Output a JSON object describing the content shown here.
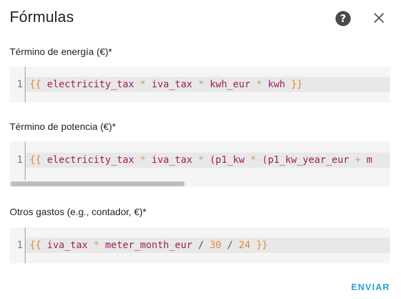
{
  "dialog": {
    "title": "Fórmulas",
    "help_icon": "help-circle-icon",
    "close_icon": "close-icon",
    "submit_label": "ENVIAR"
  },
  "fields": [
    {
      "label": "Término de energía (€)*",
      "line_number": "1",
      "tokens": [
        {
          "t": "{{",
          "c": "brace"
        },
        {
          "t": " ",
          "c": "sp"
        },
        {
          "t": "electricity_tax",
          "c": "var"
        },
        {
          "t": " ",
          "c": "sp"
        },
        {
          "t": "*",
          "c": "op"
        },
        {
          "t": " ",
          "c": "sp"
        },
        {
          "t": "iva_tax",
          "c": "var"
        },
        {
          "t": " ",
          "c": "sp"
        },
        {
          "t": "*",
          "c": "op"
        },
        {
          "t": " ",
          "c": "sp"
        },
        {
          "t": "kwh_eur",
          "c": "var"
        },
        {
          "t": " ",
          "c": "sp"
        },
        {
          "t": "*",
          "c": "op"
        },
        {
          "t": " ",
          "c": "sp"
        },
        {
          "t": "kwh",
          "c": "var"
        },
        {
          "t": " ",
          "c": "sp"
        },
        {
          "t": "}}",
          "c": "brace"
        }
      ]
    },
    {
      "label": "Término de potencia (€)*",
      "line_number": "1",
      "tokens": [
        {
          "t": "{{",
          "c": "brace"
        },
        {
          "t": " ",
          "c": "sp"
        },
        {
          "t": "electricity_tax",
          "c": "var"
        },
        {
          "t": " ",
          "c": "sp"
        },
        {
          "t": "*",
          "c": "op"
        },
        {
          "t": " ",
          "c": "sp"
        },
        {
          "t": "iva_tax",
          "c": "var"
        },
        {
          "t": " ",
          "c": "sp"
        },
        {
          "t": "*",
          "c": "op"
        },
        {
          "t": " ",
          "c": "sp"
        },
        {
          "t": "(p1_kw",
          "c": "var"
        },
        {
          "t": " ",
          "c": "sp"
        },
        {
          "t": "*",
          "c": "op"
        },
        {
          "t": " ",
          "c": "sp"
        },
        {
          "t": "(p1_kw_year_eur",
          "c": "var"
        },
        {
          "t": " ",
          "c": "sp"
        },
        {
          "t": "+",
          "c": "op"
        },
        {
          "t": " ",
          "c": "sp"
        },
        {
          "t": "m",
          "c": "var"
        }
      ]
    },
    {
      "label": "Otros gastos (e.g., contador, €)*",
      "line_number": "1",
      "tokens": [
        {
          "t": "{{",
          "c": "brace"
        },
        {
          "t": " ",
          "c": "sp"
        },
        {
          "t": "iva_tax",
          "c": "var"
        },
        {
          "t": " ",
          "c": "sp"
        },
        {
          "t": "*",
          "c": "op"
        },
        {
          "t": " ",
          "c": "sp"
        },
        {
          "t": "meter_month_eur",
          "c": "var"
        },
        {
          "t": " ",
          "c": "sp"
        },
        {
          "t": "/",
          "c": "div"
        },
        {
          "t": " ",
          "c": "sp"
        },
        {
          "t": "30",
          "c": "num"
        },
        {
          "t": " ",
          "c": "sp"
        },
        {
          "t": "/",
          "c": "div"
        },
        {
          "t": " ",
          "c": "sp"
        },
        {
          "t": "24",
          "c": "num"
        },
        {
          "t": " ",
          "c": "sp"
        },
        {
          "t": "}}",
          "c": "brace"
        }
      ]
    }
  ]
}
